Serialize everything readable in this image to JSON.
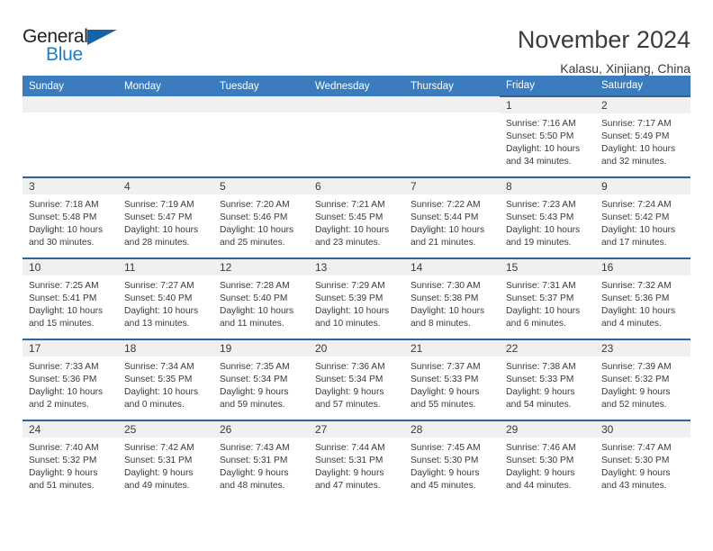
{
  "brand": {
    "name_part1": "General",
    "name_part2": "Blue",
    "logo_icon": "triangle-logo-icon",
    "accent_color": "#1464a5"
  },
  "header": {
    "title": "November 2024",
    "subtitle": "Kalasu, Xinjiang, China"
  },
  "theme": {
    "header_row_bg": "#3b7cbf",
    "row_divider": "#2f6399",
    "daynum_bg": "#f0f0f0",
    "text": "#3a3a3a"
  },
  "weekday_headers": [
    "Sunday",
    "Monday",
    "Tuesday",
    "Wednesday",
    "Thursday",
    "Friday",
    "Saturday"
  ],
  "labels": {
    "sunrise_prefix": "Sunrise: ",
    "sunset_prefix": "Sunset: ",
    "daylight_prefix": "Daylight: "
  },
  "weeks": [
    [
      {
        "empty": true
      },
      {
        "empty": true
      },
      {
        "empty": true
      },
      {
        "empty": true
      },
      {
        "empty": true
      },
      {
        "empty": false,
        "day": "1",
        "sunrise": "Sunrise: 7:16 AM",
        "sunset": "Sunset: 5:50 PM",
        "daylight": "Daylight: 10 hours and 34 minutes."
      },
      {
        "empty": false,
        "day": "2",
        "sunrise": "Sunrise: 7:17 AM",
        "sunset": "Sunset: 5:49 PM",
        "daylight": "Daylight: 10 hours and 32 minutes."
      }
    ],
    [
      {
        "empty": false,
        "day": "3",
        "sunrise": "Sunrise: 7:18 AM",
        "sunset": "Sunset: 5:48 PM",
        "daylight": "Daylight: 10 hours and 30 minutes."
      },
      {
        "empty": false,
        "day": "4",
        "sunrise": "Sunrise: 7:19 AM",
        "sunset": "Sunset: 5:47 PM",
        "daylight": "Daylight: 10 hours and 28 minutes."
      },
      {
        "empty": false,
        "day": "5",
        "sunrise": "Sunrise: 7:20 AM",
        "sunset": "Sunset: 5:46 PM",
        "daylight": "Daylight: 10 hours and 25 minutes."
      },
      {
        "empty": false,
        "day": "6",
        "sunrise": "Sunrise: 7:21 AM",
        "sunset": "Sunset: 5:45 PM",
        "daylight": "Daylight: 10 hours and 23 minutes."
      },
      {
        "empty": false,
        "day": "7",
        "sunrise": "Sunrise: 7:22 AM",
        "sunset": "Sunset: 5:44 PM",
        "daylight": "Daylight: 10 hours and 21 minutes."
      },
      {
        "empty": false,
        "day": "8",
        "sunrise": "Sunrise: 7:23 AM",
        "sunset": "Sunset: 5:43 PM",
        "daylight": "Daylight: 10 hours and 19 minutes."
      },
      {
        "empty": false,
        "day": "9",
        "sunrise": "Sunrise: 7:24 AM",
        "sunset": "Sunset: 5:42 PM",
        "daylight": "Daylight: 10 hours and 17 minutes."
      }
    ],
    [
      {
        "empty": false,
        "day": "10",
        "sunrise": "Sunrise: 7:25 AM",
        "sunset": "Sunset: 5:41 PM",
        "daylight": "Daylight: 10 hours and 15 minutes."
      },
      {
        "empty": false,
        "day": "11",
        "sunrise": "Sunrise: 7:27 AM",
        "sunset": "Sunset: 5:40 PM",
        "daylight": "Daylight: 10 hours and 13 minutes."
      },
      {
        "empty": false,
        "day": "12",
        "sunrise": "Sunrise: 7:28 AM",
        "sunset": "Sunset: 5:40 PM",
        "daylight": "Daylight: 10 hours and 11 minutes."
      },
      {
        "empty": false,
        "day": "13",
        "sunrise": "Sunrise: 7:29 AM",
        "sunset": "Sunset: 5:39 PM",
        "daylight": "Daylight: 10 hours and 10 minutes."
      },
      {
        "empty": false,
        "day": "14",
        "sunrise": "Sunrise: 7:30 AM",
        "sunset": "Sunset: 5:38 PM",
        "daylight": "Daylight: 10 hours and 8 minutes."
      },
      {
        "empty": false,
        "day": "15",
        "sunrise": "Sunrise: 7:31 AM",
        "sunset": "Sunset: 5:37 PM",
        "daylight": "Daylight: 10 hours and 6 minutes."
      },
      {
        "empty": false,
        "day": "16",
        "sunrise": "Sunrise: 7:32 AM",
        "sunset": "Sunset: 5:36 PM",
        "daylight": "Daylight: 10 hours and 4 minutes."
      }
    ],
    [
      {
        "empty": false,
        "day": "17",
        "sunrise": "Sunrise: 7:33 AM",
        "sunset": "Sunset: 5:36 PM",
        "daylight": "Daylight: 10 hours and 2 minutes."
      },
      {
        "empty": false,
        "day": "18",
        "sunrise": "Sunrise: 7:34 AM",
        "sunset": "Sunset: 5:35 PM",
        "daylight": "Daylight: 10 hours and 0 minutes."
      },
      {
        "empty": false,
        "day": "19",
        "sunrise": "Sunrise: 7:35 AM",
        "sunset": "Sunset: 5:34 PM",
        "daylight": "Daylight: 9 hours and 59 minutes."
      },
      {
        "empty": false,
        "day": "20",
        "sunrise": "Sunrise: 7:36 AM",
        "sunset": "Sunset: 5:34 PM",
        "daylight": "Daylight: 9 hours and 57 minutes."
      },
      {
        "empty": false,
        "day": "21",
        "sunrise": "Sunrise: 7:37 AM",
        "sunset": "Sunset: 5:33 PM",
        "daylight": "Daylight: 9 hours and 55 minutes."
      },
      {
        "empty": false,
        "day": "22",
        "sunrise": "Sunrise: 7:38 AM",
        "sunset": "Sunset: 5:33 PM",
        "daylight": "Daylight: 9 hours and 54 minutes."
      },
      {
        "empty": false,
        "day": "23",
        "sunrise": "Sunrise: 7:39 AM",
        "sunset": "Sunset: 5:32 PM",
        "daylight": "Daylight: 9 hours and 52 minutes."
      }
    ],
    [
      {
        "empty": false,
        "day": "24",
        "sunrise": "Sunrise: 7:40 AM",
        "sunset": "Sunset: 5:32 PM",
        "daylight": "Daylight: 9 hours and 51 minutes."
      },
      {
        "empty": false,
        "day": "25",
        "sunrise": "Sunrise: 7:42 AM",
        "sunset": "Sunset: 5:31 PM",
        "daylight": "Daylight: 9 hours and 49 minutes."
      },
      {
        "empty": false,
        "day": "26",
        "sunrise": "Sunrise: 7:43 AM",
        "sunset": "Sunset: 5:31 PM",
        "daylight": "Daylight: 9 hours and 48 minutes."
      },
      {
        "empty": false,
        "day": "27",
        "sunrise": "Sunrise: 7:44 AM",
        "sunset": "Sunset: 5:31 PM",
        "daylight": "Daylight: 9 hours and 47 minutes."
      },
      {
        "empty": false,
        "day": "28",
        "sunrise": "Sunrise: 7:45 AM",
        "sunset": "Sunset: 5:30 PM",
        "daylight": "Daylight: 9 hours and 45 minutes."
      },
      {
        "empty": false,
        "day": "29",
        "sunrise": "Sunrise: 7:46 AM",
        "sunset": "Sunset: 5:30 PM",
        "daylight": "Daylight: 9 hours and 44 minutes."
      },
      {
        "empty": false,
        "day": "30",
        "sunrise": "Sunrise: 7:47 AM",
        "sunset": "Sunset: 5:30 PM",
        "daylight": "Daylight: 9 hours and 43 minutes."
      }
    ]
  ]
}
